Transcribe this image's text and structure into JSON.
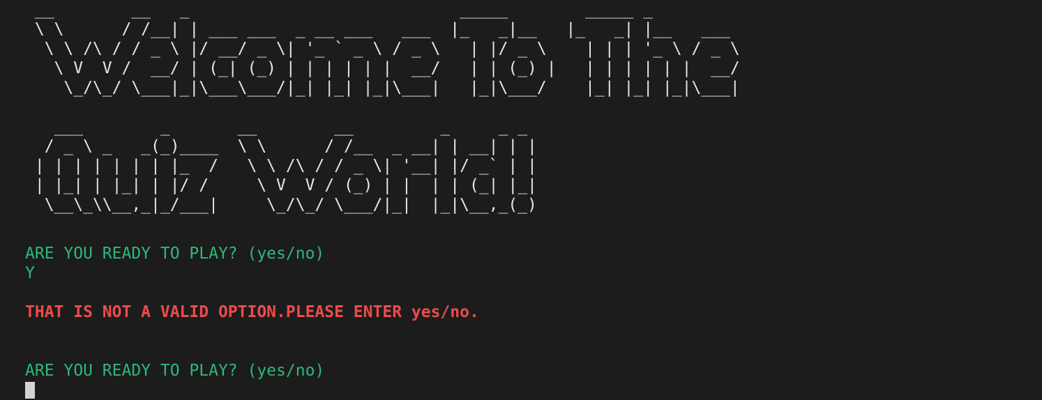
{
  "banner": {
    "welcome_art": " __        __   _                            _____        _____ _          \n \\ \\      / /__| | ___ ___  _ __ ___   ___  |_   _|__   |_   _| |__   ___ \n  \\ \\ /\\ / / _ \\ |/ __/ _ \\| '_ ` _ \\ / _ \\   | |/ _ \\    | | | '_ \\ / _ \\\n   \\ V  V /  __/ | (_| (_) | | | | | |  __/   | | (_) |   | | | | | |  __/\n    \\_/\\_/ \\___|_|\\___\\___/|_| |_| |_|\\___|   |_|\\___/    |_| |_| |_|\\___|",
    "quiz_art": "   ___        _       __        __         _     _ _ \n  / _ \\ _   _(_)____  \\ \\      / /__  _ __| | __| | |\n | | | | | | | |_  /   \\ \\ /\\ / / _ \\| '__| |/ _` | |\n | |_| | |_| | |/ /     \\ V  V / (_) | |  | | (_| |_|\n  \\__\\_\\\\__,_|_/___|     \\_/\\_/ \\___/|_|  |_|\\__,_(_)"
  },
  "session": {
    "prompt_1": "ARE YOU READY TO PLAY? (yes/no)",
    "user_input_1": "Y",
    "error_message": "THAT IS NOT A VALID OPTION.PLEASE ENTER yes/no.",
    "prompt_2": "ARE YOU READY TO PLAY? (yes/no)"
  },
  "colors": {
    "background": "#1c1c1c",
    "prompt": "#2eb87a",
    "error": "#ee4b4b",
    "banner": "#e6e6e6",
    "cursor": "#d4d4d4"
  }
}
